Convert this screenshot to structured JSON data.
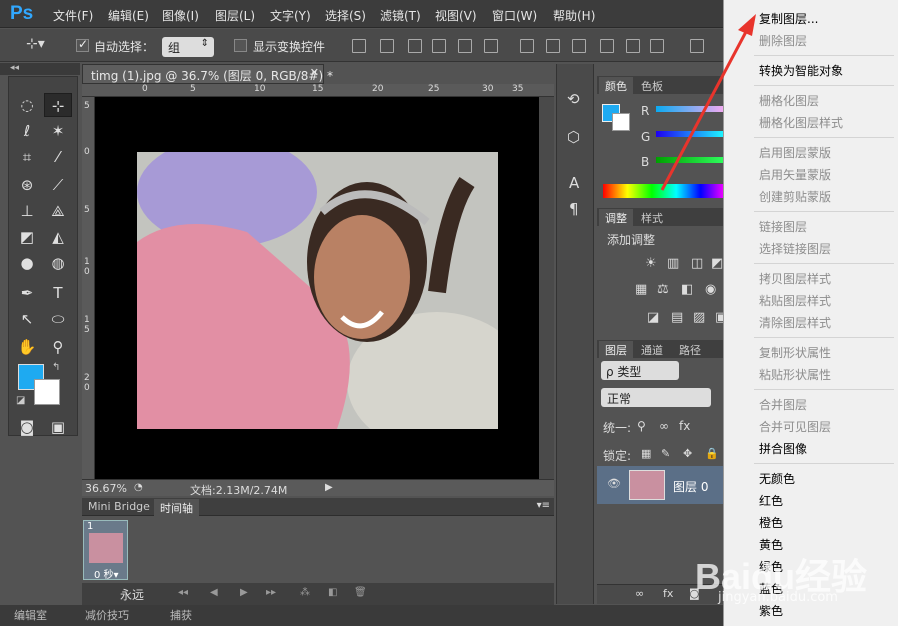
{
  "app": {
    "logo": "Ps"
  },
  "menu": [
    "文件(F)",
    "编辑(E)",
    "图像(I)",
    "图层(L)",
    "文字(Y)",
    "选择(S)",
    "滤镜(T)",
    "视图(V)",
    "窗口(W)",
    "帮助(H)"
  ],
  "options": {
    "auto_select_label": "自动选择：",
    "auto_select_value": "组",
    "show_transform_label": "显示变换控件"
  },
  "document": {
    "tab_title": "timg (1).jpg @ 36.7% (图层 0, RGB/8#) *",
    "zoom": "36.67%",
    "doc_info": "文档:2.13M/2.74M",
    "ruler_h": [
      "0",
      "5",
      "10",
      "15",
      "20",
      "25",
      "30",
      "35"
    ],
    "ruler_v": [
      "5",
      "0",
      "5",
      "1 0",
      "1 5",
      "2 0"
    ]
  },
  "timeline": {
    "tabs": [
      "Mini Bridge",
      "时间轴"
    ],
    "frame_number": "1",
    "frame_delay": "0 秒▾",
    "loop": "永远"
  },
  "panels": {
    "color_tabs": [
      "颜色",
      "色板"
    ],
    "channels": [
      "R",
      "G",
      "B"
    ],
    "adjust_tabs": [
      "调整",
      "样式"
    ],
    "adjust_title": "添加调整",
    "layers_tabs": [
      "图层",
      "通道",
      "路径"
    ],
    "filter_kind": "ρ 类型",
    "blend_mode": "正常",
    "unify_label": "统一:",
    "lock_label": "锁定:",
    "layer_name": "图层 0"
  },
  "context_menu": [
    {
      "label": "复制图层...",
      "enabled": true
    },
    {
      "label": "删除图层",
      "enabled": false
    },
    {
      "label": "转换为智能对象",
      "enabled": true
    },
    {
      "label": "栅格化图层",
      "enabled": false
    },
    {
      "label": "栅格化图层样式",
      "enabled": false
    },
    {
      "label": "启用图层蒙版",
      "enabled": false
    },
    {
      "label": "启用矢量蒙版",
      "enabled": false
    },
    {
      "label": "创建剪贴蒙版",
      "enabled": false
    },
    {
      "label": "链接图层",
      "enabled": false
    },
    {
      "label": "选择链接图层",
      "enabled": false
    },
    {
      "label": "拷贝图层样式",
      "enabled": false
    },
    {
      "label": "粘贴图层样式",
      "enabled": false
    },
    {
      "label": "清除图层样式",
      "enabled": false
    },
    {
      "label": "复制形状属性",
      "enabled": false
    },
    {
      "label": "粘贴形状属性",
      "enabled": false
    },
    {
      "label": "合并图层",
      "enabled": false
    },
    {
      "label": "合并可见图层",
      "enabled": false
    },
    {
      "label": "拼合图像",
      "enabled": true
    },
    {
      "label": "无颜色",
      "enabled": true
    },
    {
      "label": "红色",
      "enabled": true
    },
    {
      "label": "橙色",
      "enabled": true
    },
    {
      "label": "黄色",
      "enabled": true
    },
    {
      "label": "绿色",
      "enabled": true
    },
    {
      "label": "蓝色",
      "enabled": true
    },
    {
      "label": "紫色",
      "enabled": true
    }
  ],
  "bottom_bar": [
    "编辑室",
    "减价技巧",
    "捕获"
  ],
  "watermark": {
    "brand": "Baidu经验",
    "url": "jingyan.baidu.com"
  },
  "colors": {
    "foreground": "#1eaaf1",
    "background": "#ffffff",
    "annotation_arrow": "#e8342c"
  }
}
